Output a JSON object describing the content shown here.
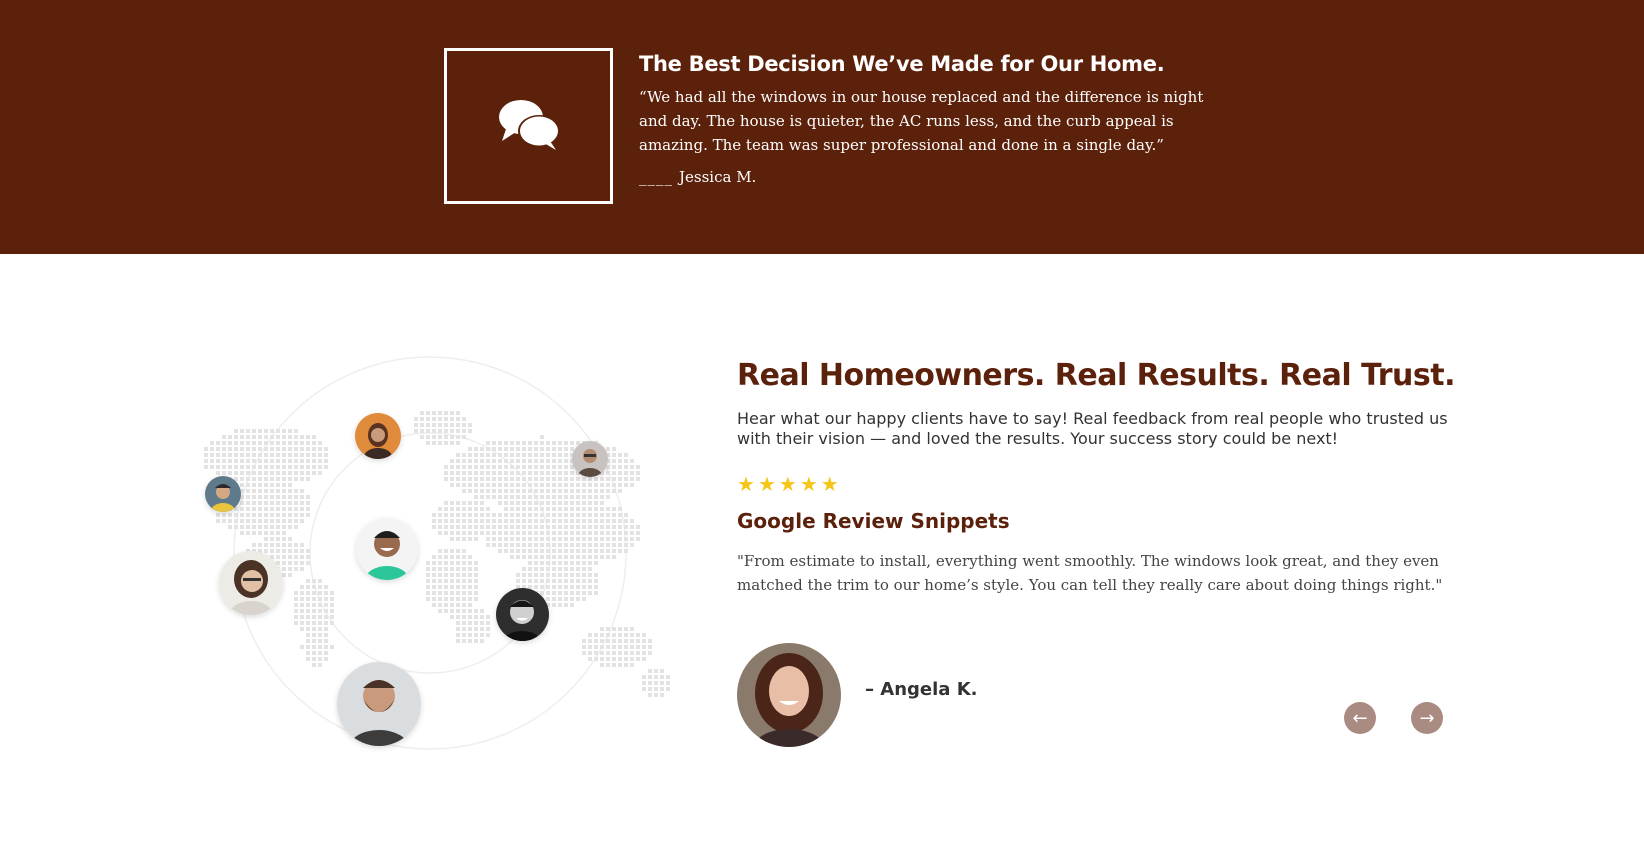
{
  "band": {
    "title": "The Best Decision We’ve Made for Our Home.",
    "quote": "“We had all the windows in our house replaced and the difference is night and day. The house is quieter, the AC runs less, and the curb appeal is amazing. The team was super professional and done in a single day.”",
    "author_dash": "____",
    "author": "Jessica M.",
    "icon": "chat-bubbles-icon",
    "background": "#5c210b"
  },
  "main": {
    "heading": "Real Homeowners. Real Results. Real Trust.",
    "subheading": "Hear what our happy clients have to say! Real feedback from real people who trusted us with their vision — and loved the results. Your success story could be next!",
    "rating": {
      "stars": 5,
      "max": 5,
      "color": "#f5c518"
    },
    "snippet_title": "Google Review Snippets",
    "snippet_text": "\"From estimate to install, everything went smoothly. The windows look great, and they even matched the trim to our home’s style. You can tell they really care about doing things right.\"",
    "reviewer_name": "– Angela K.",
    "heading_color": "#5c210b"
  },
  "nav": {
    "prev_icon": "arrow-left-icon",
    "next_icon": "arrow-right-icon",
    "prev_glyph": "←",
    "next_glyph": "→",
    "button_color": "#a98b82"
  }
}
